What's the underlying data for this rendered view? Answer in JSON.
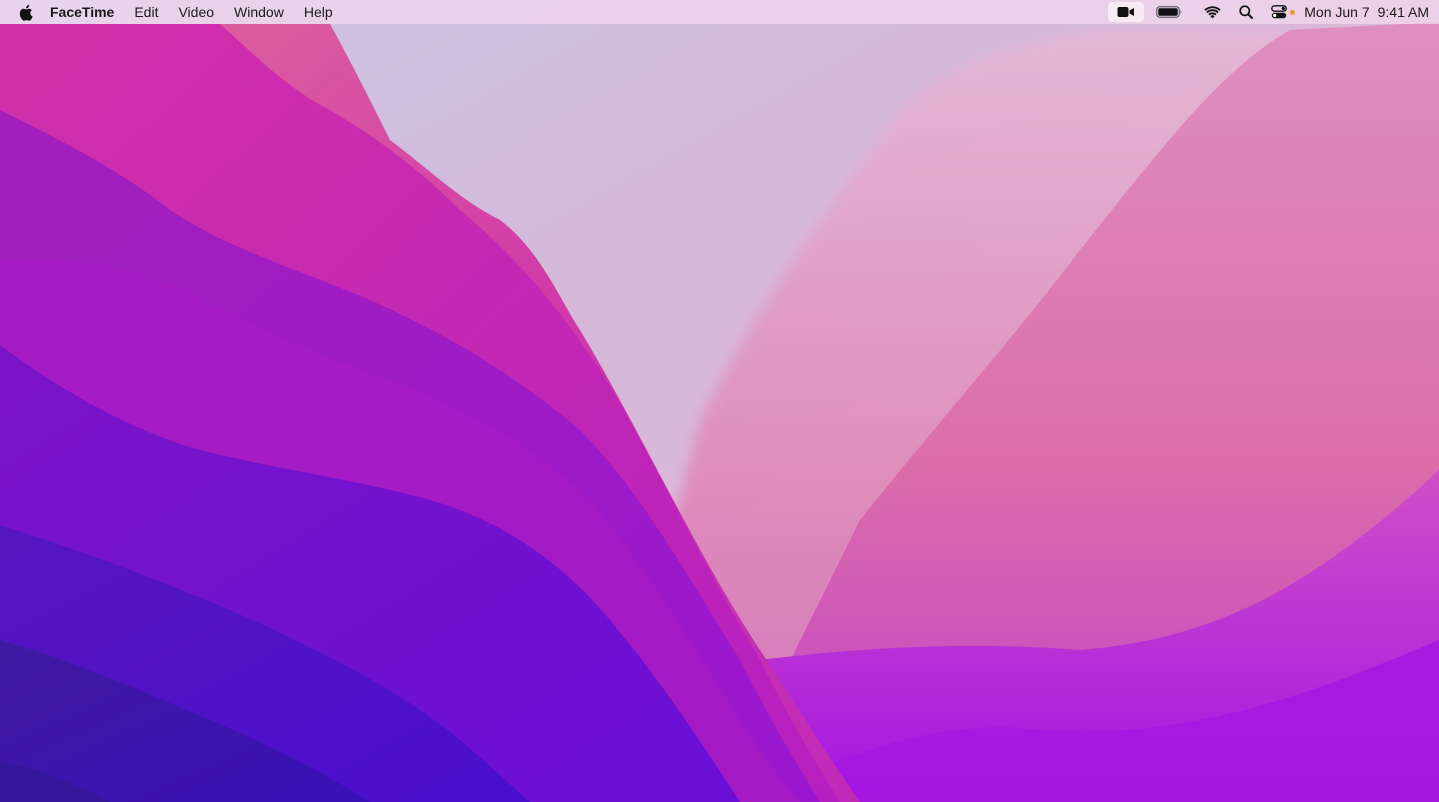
{
  "menubar": {
    "app_name": "FaceTime",
    "menus": [
      "Edit",
      "Video",
      "Window",
      "Help"
    ],
    "date": "Mon Jun 7",
    "time": "9:41 AM"
  },
  "icons": {
    "apple": "apple-logo-icon",
    "camera": "video-camera-icon",
    "battery": "battery-icon",
    "wifi": "wifi-icon",
    "search": "spotlight-search-icon",
    "control_center": "control-center-icon"
  },
  "colors": {
    "camera_indicator": "#f19a2b"
  }
}
